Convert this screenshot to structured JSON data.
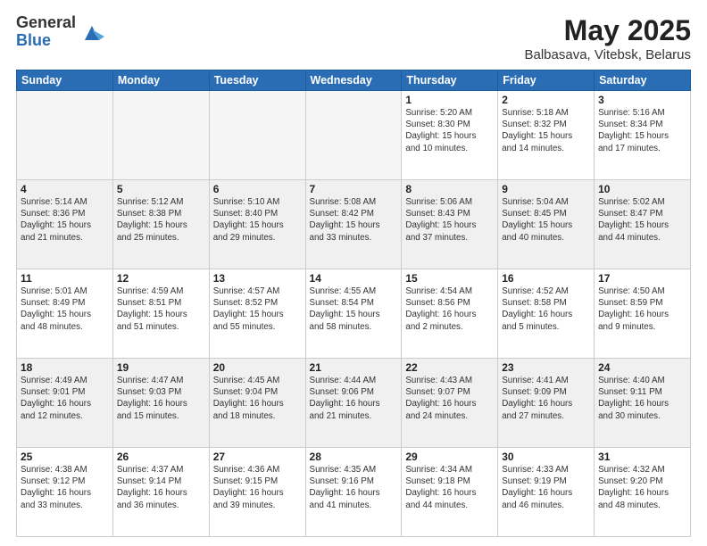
{
  "logo": {
    "general": "General",
    "blue": "Blue"
  },
  "title": {
    "month_year": "May 2025",
    "location": "Balbasava, Vitebsk, Belarus"
  },
  "weekdays": [
    "Sunday",
    "Monday",
    "Tuesday",
    "Wednesday",
    "Thursday",
    "Friday",
    "Saturday"
  ],
  "weeks": [
    [
      {
        "day": "",
        "info": ""
      },
      {
        "day": "",
        "info": ""
      },
      {
        "day": "",
        "info": ""
      },
      {
        "day": "",
        "info": ""
      },
      {
        "day": "1",
        "info": "Sunrise: 5:20 AM\nSunset: 8:30 PM\nDaylight: 15 hours\nand 10 minutes."
      },
      {
        "day": "2",
        "info": "Sunrise: 5:18 AM\nSunset: 8:32 PM\nDaylight: 15 hours\nand 14 minutes."
      },
      {
        "day": "3",
        "info": "Sunrise: 5:16 AM\nSunset: 8:34 PM\nDaylight: 15 hours\nand 17 minutes."
      }
    ],
    [
      {
        "day": "4",
        "info": "Sunrise: 5:14 AM\nSunset: 8:36 PM\nDaylight: 15 hours\nand 21 minutes."
      },
      {
        "day": "5",
        "info": "Sunrise: 5:12 AM\nSunset: 8:38 PM\nDaylight: 15 hours\nand 25 minutes."
      },
      {
        "day": "6",
        "info": "Sunrise: 5:10 AM\nSunset: 8:40 PM\nDaylight: 15 hours\nand 29 minutes."
      },
      {
        "day": "7",
        "info": "Sunrise: 5:08 AM\nSunset: 8:42 PM\nDaylight: 15 hours\nand 33 minutes."
      },
      {
        "day": "8",
        "info": "Sunrise: 5:06 AM\nSunset: 8:43 PM\nDaylight: 15 hours\nand 37 minutes."
      },
      {
        "day": "9",
        "info": "Sunrise: 5:04 AM\nSunset: 8:45 PM\nDaylight: 15 hours\nand 40 minutes."
      },
      {
        "day": "10",
        "info": "Sunrise: 5:02 AM\nSunset: 8:47 PM\nDaylight: 15 hours\nand 44 minutes."
      }
    ],
    [
      {
        "day": "11",
        "info": "Sunrise: 5:01 AM\nSunset: 8:49 PM\nDaylight: 15 hours\nand 48 minutes."
      },
      {
        "day": "12",
        "info": "Sunrise: 4:59 AM\nSunset: 8:51 PM\nDaylight: 15 hours\nand 51 minutes."
      },
      {
        "day": "13",
        "info": "Sunrise: 4:57 AM\nSunset: 8:52 PM\nDaylight: 15 hours\nand 55 minutes."
      },
      {
        "day": "14",
        "info": "Sunrise: 4:55 AM\nSunset: 8:54 PM\nDaylight: 15 hours\nand 58 minutes."
      },
      {
        "day": "15",
        "info": "Sunrise: 4:54 AM\nSunset: 8:56 PM\nDaylight: 16 hours\nand 2 minutes."
      },
      {
        "day": "16",
        "info": "Sunrise: 4:52 AM\nSunset: 8:58 PM\nDaylight: 16 hours\nand 5 minutes."
      },
      {
        "day": "17",
        "info": "Sunrise: 4:50 AM\nSunset: 8:59 PM\nDaylight: 16 hours\nand 9 minutes."
      }
    ],
    [
      {
        "day": "18",
        "info": "Sunrise: 4:49 AM\nSunset: 9:01 PM\nDaylight: 16 hours\nand 12 minutes."
      },
      {
        "day": "19",
        "info": "Sunrise: 4:47 AM\nSunset: 9:03 PM\nDaylight: 16 hours\nand 15 minutes."
      },
      {
        "day": "20",
        "info": "Sunrise: 4:45 AM\nSunset: 9:04 PM\nDaylight: 16 hours\nand 18 minutes."
      },
      {
        "day": "21",
        "info": "Sunrise: 4:44 AM\nSunset: 9:06 PM\nDaylight: 16 hours\nand 21 minutes."
      },
      {
        "day": "22",
        "info": "Sunrise: 4:43 AM\nSunset: 9:07 PM\nDaylight: 16 hours\nand 24 minutes."
      },
      {
        "day": "23",
        "info": "Sunrise: 4:41 AM\nSunset: 9:09 PM\nDaylight: 16 hours\nand 27 minutes."
      },
      {
        "day": "24",
        "info": "Sunrise: 4:40 AM\nSunset: 9:11 PM\nDaylight: 16 hours\nand 30 minutes."
      }
    ],
    [
      {
        "day": "25",
        "info": "Sunrise: 4:38 AM\nSunset: 9:12 PM\nDaylight: 16 hours\nand 33 minutes."
      },
      {
        "day": "26",
        "info": "Sunrise: 4:37 AM\nSunset: 9:14 PM\nDaylight: 16 hours\nand 36 minutes."
      },
      {
        "day": "27",
        "info": "Sunrise: 4:36 AM\nSunset: 9:15 PM\nDaylight: 16 hours\nand 39 minutes."
      },
      {
        "day": "28",
        "info": "Sunrise: 4:35 AM\nSunset: 9:16 PM\nDaylight: 16 hours\nand 41 minutes."
      },
      {
        "day": "29",
        "info": "Sunrise: 4:34 AM\nSunset: 9:18 PM\nDaylight: 16 hours\nand 44 minutes."
      },
      {
        "day": "30",
        "info": "Sunrise: 4:33 AM\nSunset: 9:19 PM\nDaylight: 16 hours\nand 46 minutes."
      },
      {
        "day": "31",
        "info": "Sunrise: 4:32 AM\nSunset: 9:20 PM\nDaylight: 16 hours\nand 48 minutes."
      }
    ]
  ]
}
